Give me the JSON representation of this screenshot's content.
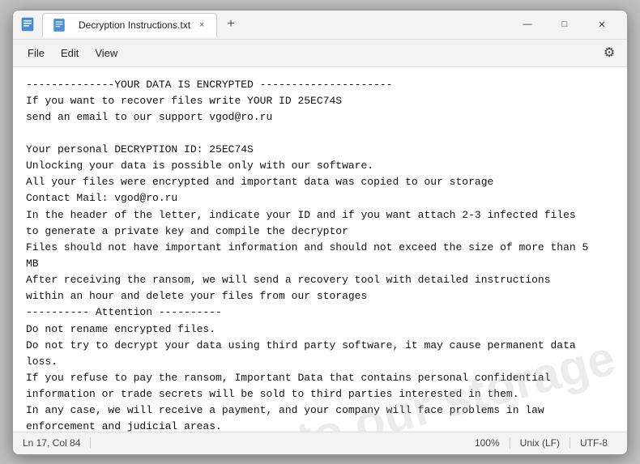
{
  "window": {
    "title": "Decryption Instructions.txt",
    "icon": "text-file-icon"
  },
  "titlebar": {
    "tab_label": "Decryption Instructions.txt",
    "tab_close": "×",
    "new_tab": "+",
    "minimize": "—",
    "maximize": "□",
    "close": "✕"
  },
  "menubar": {
    "items": [
      "File",
      "Edit",
      "View"
    ],
    "gear_label": "⚙"
  },
  "content": {
    "text": "--------------YOUR DATA IS ENCRYPTED ---------------------\nIf you want to recover files write YOUR ID 25EC74S\nsend an email to our support vgod@ro.ru\n\nYour personal DECRYPTION ID: 25EC74S\nUnlocking your data is possible only with our software.\nAll your files were encrypted and important data was copied to our storage\nContact Mail: vgod@ro.ru\nIn the header of the letter, indicate your ID and if you want attach 2-3 infected files\nto generate a private key and compile the decryptor\nFiles should not have important information and should not exceed the size of more than 5\nMB\nAfter receiving the ransom, we will send a recovery tool with detailed instructions\nwithin an hour and delete your files from our storages\n---------- Attention ----------\nDo not rename encrypted files.\nDo not try to decrypt your data using third party software, it may cause permanent data\nloss.\nIf you refuse to pay the ransom, Important Data that contains personal confidential\ninformation or trade secrets will be sold to third parties interested in them.\nIn any case, we will receive a payment, and your company will face problems in law\nenforcement and judicial areas.\nDon't be afraid to contact us. Remember, this is the only way to recover your data.|"
  },
  "statusbar": {
    "position": "Ln 17, Col 84",
    "zoom": "100%",
    "line_ending": "Unix (LF)",
    "encoding": "UTF-8"
  }
}
